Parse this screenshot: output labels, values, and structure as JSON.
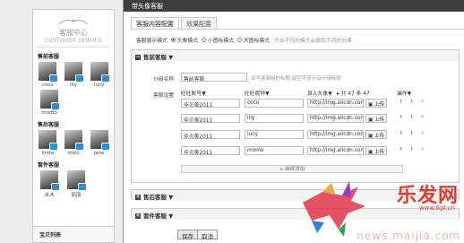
{
  "left_panel": {
    "header_cn": "客服中心",
    "header_en": "CUSTOMER SERVICE",
    "groups": [
      {
        "title": "售前客服",
        "members": [
          "coco",
          "lily",
          "lucy",
          "momo"
        ]
      },
      {
        "title": "售后客服",
        "members": [
          "linda",
          "mico",
          "jane"
        ]
      },
      {
        "title": "套件客服",
        "members": [
          "冰冰",
          "丽丽"
        ]
      }
    ],
    "bottom_tab": "宝贝列表"
  },
  "dialog": {
    "title": "带头像客服",
    "tabs": [
      "客服内容配置",
      "效果配置"
    ],
    "mode": {
      "label": "客服展示模式",
      "options": [
        "头象模式",
        "小图标模式",
        "大图标模式"
      ],
      "selected": 0,
      "hint": "开启不同的模式会展现不同的效果"
    },
    "pre_sales": {
      "title": "售前客服 ▼",
      "group_name_label": "分组名称",
      "group_name_value": "售前客服",
      "group_name_hint": "填写客服组的标题,留空不显示该分组标题",
      "settings_label": "客服设置",
      "columns": [
        "旺旺账号▼",
        "旺旺昵称▼",
        "真人头象▼",
        "操作▼"
      ],
      "count_text": "▸ 共 47 条 47",
      "rows": [
        {
          "account": "佳贝美2011",
          "nickname": "coco",
          "avatar": "http://img.alicdn.com"
        },
        {
          "account": "佳贝美2011",
          "nickname": "lily",
          "avatar": "http://img.alicdn.com"
        },
        {
          "account": "佳贝美2011",
          "nickname": "lucy",
          "avatar": "http://img.alicdn.com"
        },
        {
          "account": "佳贝美2011",
          "nickname": "momo",
          "avatar": "http://img.alicdn.com"
        }
      ],
      "upload_label": "上传",
      "add_label": "+ 继续添加"
    },
    "after_sales_title": "售后客服 ▼",
    "suite_title": "套件客服 ▼",
    "save_label": "保存",
    "cancel_label": "取消"
  },
  "watermark": {
    "logo": "乐发网",
    "small": "www.6pf.cn",
    "url": "news.maijia.com"
  }
}
